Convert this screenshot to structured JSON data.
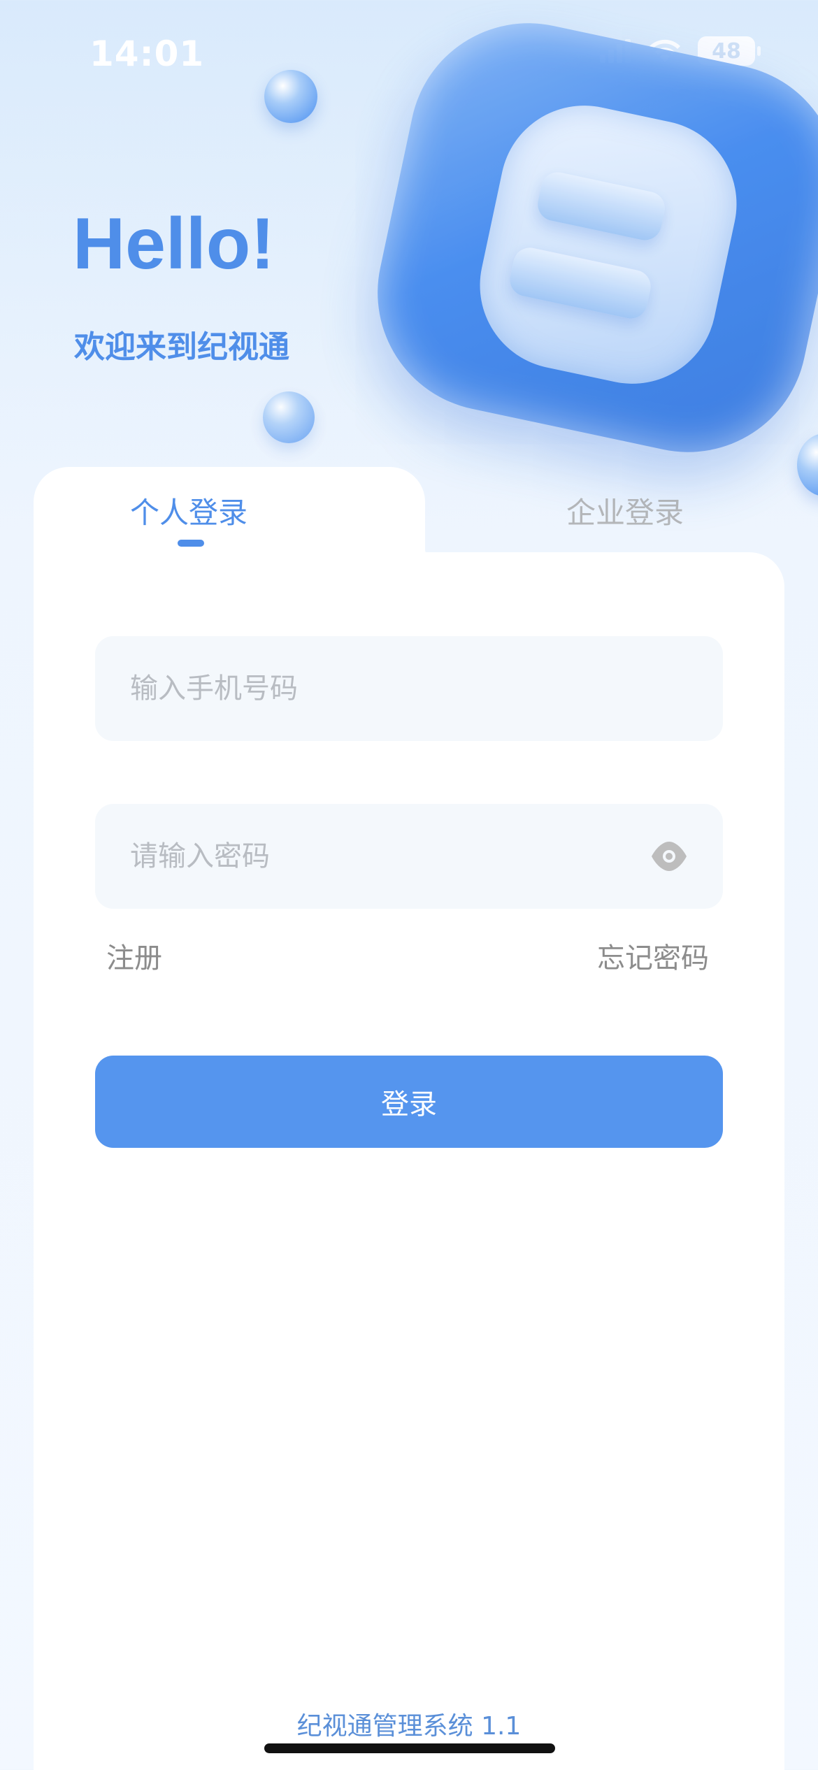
{
  "status_bar": {
    "time": "14:01",
    "battery": "48"
  },
  "hero": {
    "greeting": "Hello!",
    "welcome": "欢迎来到纪视通"
  },
  "tabs": [
    {
      "label": "个人登录",
      "active": true
    },
    {
      "label": "企业登录",
      "active": false
    }
  ],
  "form": {
    "phone_placeholder": "输入手机号码",
    "phone_value": "",
    "password_placeholder": "请输入密码",
    "password_value": "",
    "register_label": "注册",
    "forgot_label": "忘记密码",
    "login_label": "登录"
  },
  "footer": {
    "version_text": "纪视通管理系统 1.1"
  },
  "colors": {
    "accent": "#4f8ee9",
    "button": "#5595ee",
    "field_bg": "#f4f8fc"
  }
}
